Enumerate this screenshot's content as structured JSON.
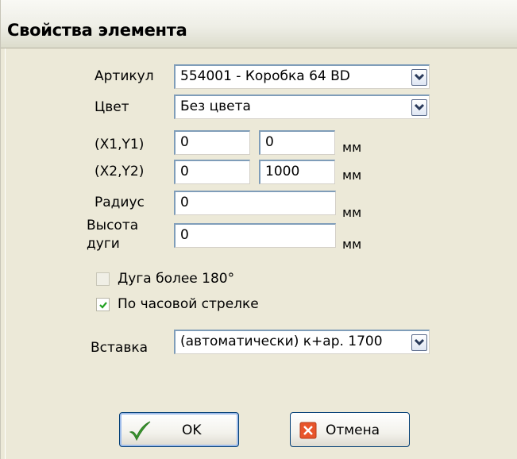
{
  "window": {
    "title": "Свойства элемента"
  },
  "form": {
    "article": {
      "label": "Артикул",
      "value": "554001 - Коробка 64 BD"
    },
    "color": {
      "label": "Цвет",
      "value": "Без цвета"
    },
    "p1": {
      "label": "(X1,Y1)",
      "x": "0",
      "y": "0",
      "unit": "мм"
    },
    "p2": {
      "label": "(X2,Y2)",
      "x": "0",
      "y": "1000",
      "unit": "мм"
    },
    "radius": {
      "label": "Радиус",
      "value": "0",
      "unit": "мм"
    },
    "arc_height": {
      "label_line1": "Высота",
      "label_line2": "дуги",
      "value": "0",
      "unit": "мм"
    },
    "arc_over_180": {
      "label": "Дуга более 180°",
      "checked": false,
      "enabled": false
    },
    "clockwise": {
      "label": "По часовой стрелке",
      "checked": true
    },
    "insert": {
      "label": "Вставка",
      "value": "(автоматически) к+ар. 1700"
    }
  },
  "buttons": {
    "ok": {
      "label": "OK",
      "icon": "checkmark-icon"
    },
    "cancel": {
      "label": "Отмена",
      "icon": "close-icon"
    }
  },
  "colors": {
    "checkmark": "#3b9b2f",
    "cancel_icon": "#e8552b",
    "field_border": "#7f9db9"
  }
}
